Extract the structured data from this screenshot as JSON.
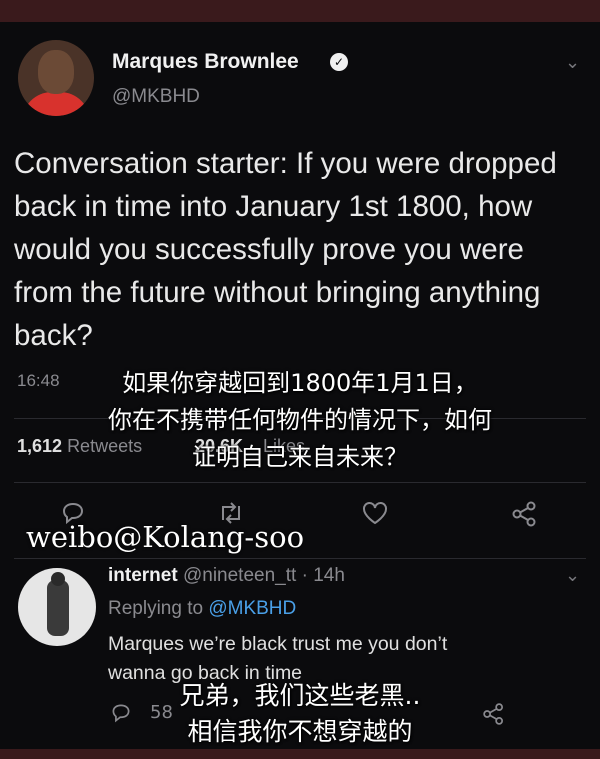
{
  "tweet": {
    "name": "Marques Brownlee",
    "handle": "@MKBHD",
    "text": "Conversation starter: If you were dropped back in time into January 1st 1800, how would you successfully prove you were from the future without bringing anything back?",
    "time": "16:48",
    "retweets_count": "1,612",
    "retweets_label": "Retweets",
    "likes_count": "20.6K",
    "likes_label": "Likes",
    "icons": {
      "verified": "verified-badge-icon",
      "menu": "chevron-down-icon",
      "reply": "reply-icon",
      "retweet": "retweet-icon",
      "like": "heart-icon",
      "share": "share-icon"
    }
  },
  "subtitle_top": {
    "line1": "如果你穿越回到1800年1月1日，",
    "line2": "你在不携带任何物件的情况下，如何",
    "line3": "证明自己来自未来？"
  },
  "watermark": "weibo@Kolang-soo",
  "reply": {
    "name": "internet",
    "handle": "@nineteen_tt",
    "separator": " · ",
    "time": "14h",
    "replying_to_label": "Replying to ",
    "replying_to_handle": "@MKBHD",
    "text_line1": "Marques we’re black trust me you don’t",
    "text_line2": "wanna go back in time",
    "reply_count": "58"
  },
  "subtitle_bottom": {
    "line1": "兄弟，我们这些老黑..",
    "line2": "相信我你不想穿越的"
  },
  "colors": {
    "background": "#0b0b0d",
    "frame": "#3a1a1c",
    "mention": "#4aa0e8",
    "muted": "#8a8a8f"
  }
}
